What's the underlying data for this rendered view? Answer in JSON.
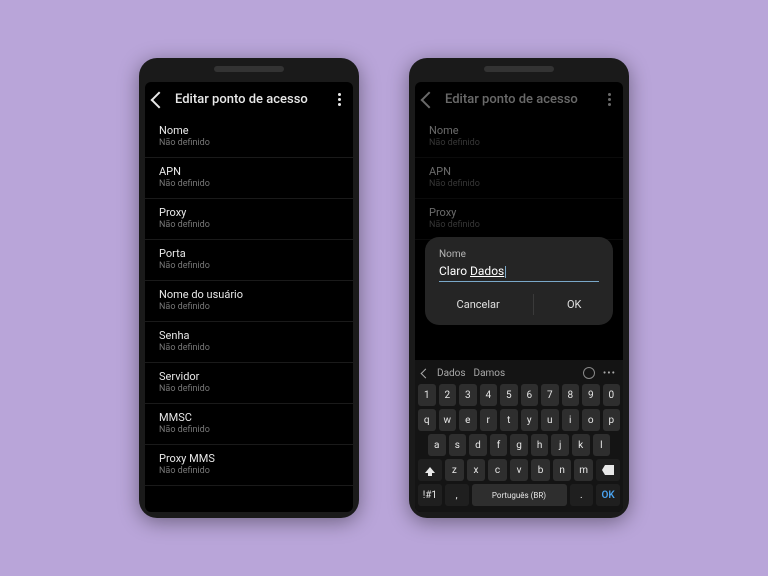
{
  "header": {
    "title": "Editar ponto de acesso"
  },
  "undefined_text": "Não definido",
  "list_items": [
    {
      "label": "Nome"
    },
    {
      "label": "APN"
    },
    {
      "label": "Proxy"
    },
    {
      "label": "Porta"
    },
    {
      "label": "Nome do usuário"
    },
    {
      "label": "Senha"
    },
    {
      "label": "Servidor"
    },
    {
      "label": "MMSC"
    },
    {
      "label": "Proxy MMS"
    }
  ],
  "right_visible_items": [
    {
      "label": "Nome"
    },
    {
      "label": "APN"
    },
    {
      "label": "Proxy"
    }
  ],
  "dialog": {
    "title": "Nome",
    "value_word1": "Claro ",
    "value_word2": "Dados",
    "cancel": "Cancelar",
    "ok": "OK"
  },
  "keyboard": {
    "suggestions": [
      "Dados",
      "Damos"
    ],
    "row1": [
      "1",
      "2",
      "3",
      "4",
      "5",
      "6",
      "7",
      "8",
      "9",
      "0"
    ],
    "row2": [
      "q",
      "w",
      "e",
      "r",
      "t",
      "y",
      "u",
      "i",
      "o",
      "p"
    ],
    "row3": [
      "a",
      "s",
      "d",
      "f",
      "g",
      "h",
      "j",
      "k",
      "l"
    ],
    "row4_mid": [
      "z",
      "x",
      "c",
      "v",
      "b",
      "n",
      "m"
    ],
    "bottom": {
      "sym": "!#1",
      "comma": ",",
      "space": "Português (BR)",
      "dot": ".",
      "ok": "OK"
    }
  }
}
